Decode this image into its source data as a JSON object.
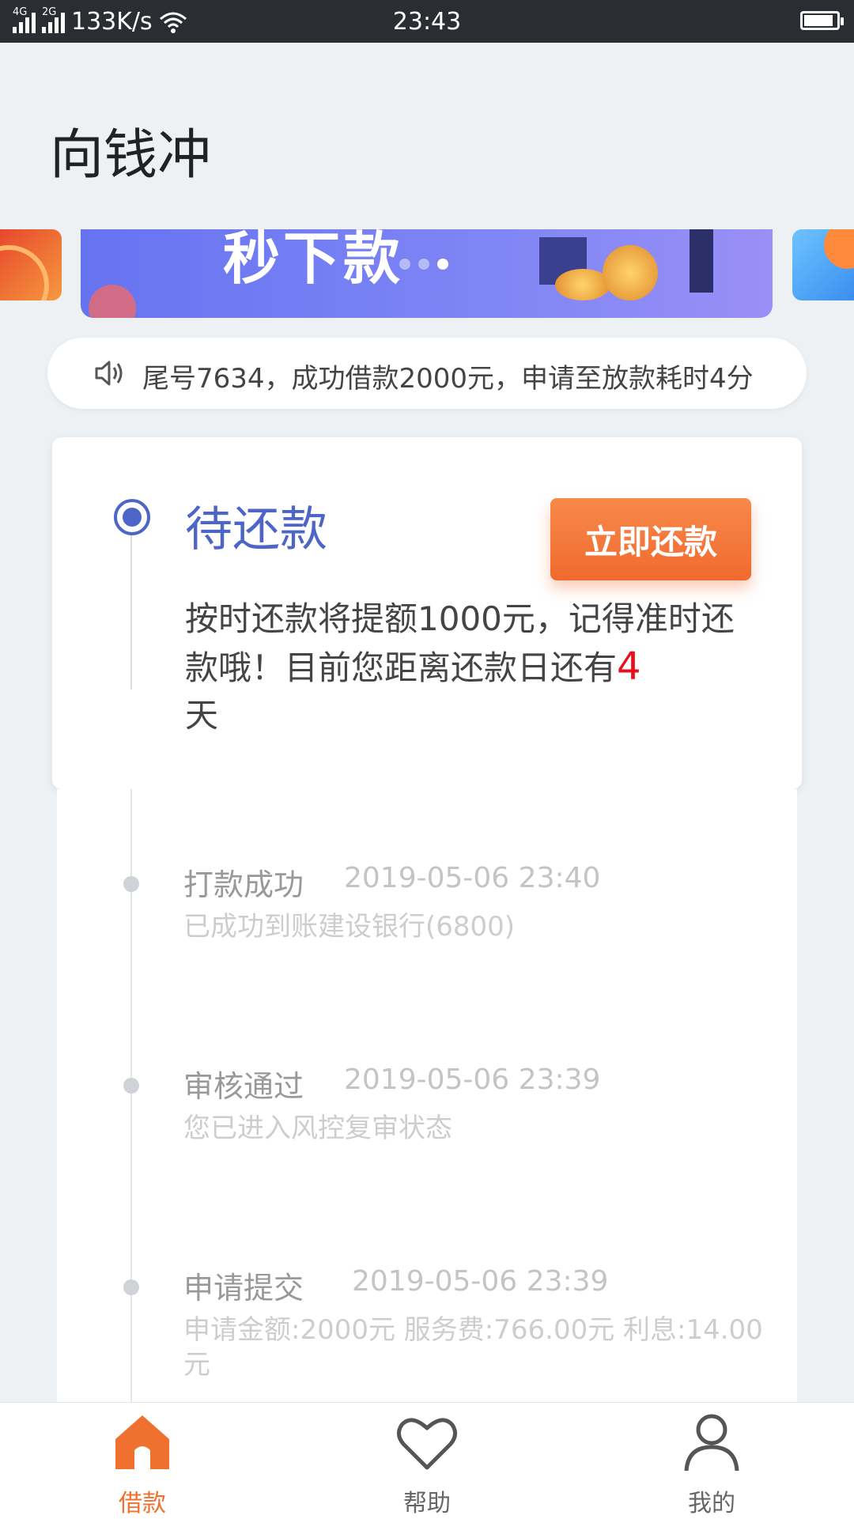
{
  "status_bar": {
    "signal1": "4G",
    "signal2": "2G",
    "speed": "133K/s",
    "time": "23:43",
    "battery_level": 0.9
  },
  "app": {
    "title": "向钱冲"
  },
  "banner": {
    "headline": "秒下款",
    "page_count": 3,
    "active_index": 2
  },
  "notice": {
    "icon": "speaker-icon",
    "text": "尾号7634，成功借款2000元，申请至放款耗时4分"
  },
  "loan_card": {
    "status": "待还款",
    "action_label": "立即还款",
    "desc_before": "按时还款将提额1000元，记得准时还款哦！目前您距离还款日还有",
    "days": "4",
    "desc_after": "天",
    "accent": "#4d65c6",
    "button_color": "#f0702f"
  },
  "timeline": [
    {
      "title": "打款成功",
      "time": "2019-05-06 23:40",
      "detail": "已成功到账建设银行(6800)"
    },
    {
      "title": "审核通过",
      "time": "2019-05-06 23:39",
      "detail": "您已进入风控复审状态"
    },
    {
      "title": "申请提交",
      "time": "2019-05-06 23:39",
      "detail": "申请金额:2000元  服务费:766.00元 利息:14.00元"
    }
  ],
  "tabs": [
    {
      "label": "借款",
      "icon": "home-icon",
      "active": true
    },
    {
      "label": "帮助",
      "icon": "heart-icon",
      "active": false
    },
    {
      "label": "我的",
      "icon": "user-icon",
      "active": false
    }
  ]
}
